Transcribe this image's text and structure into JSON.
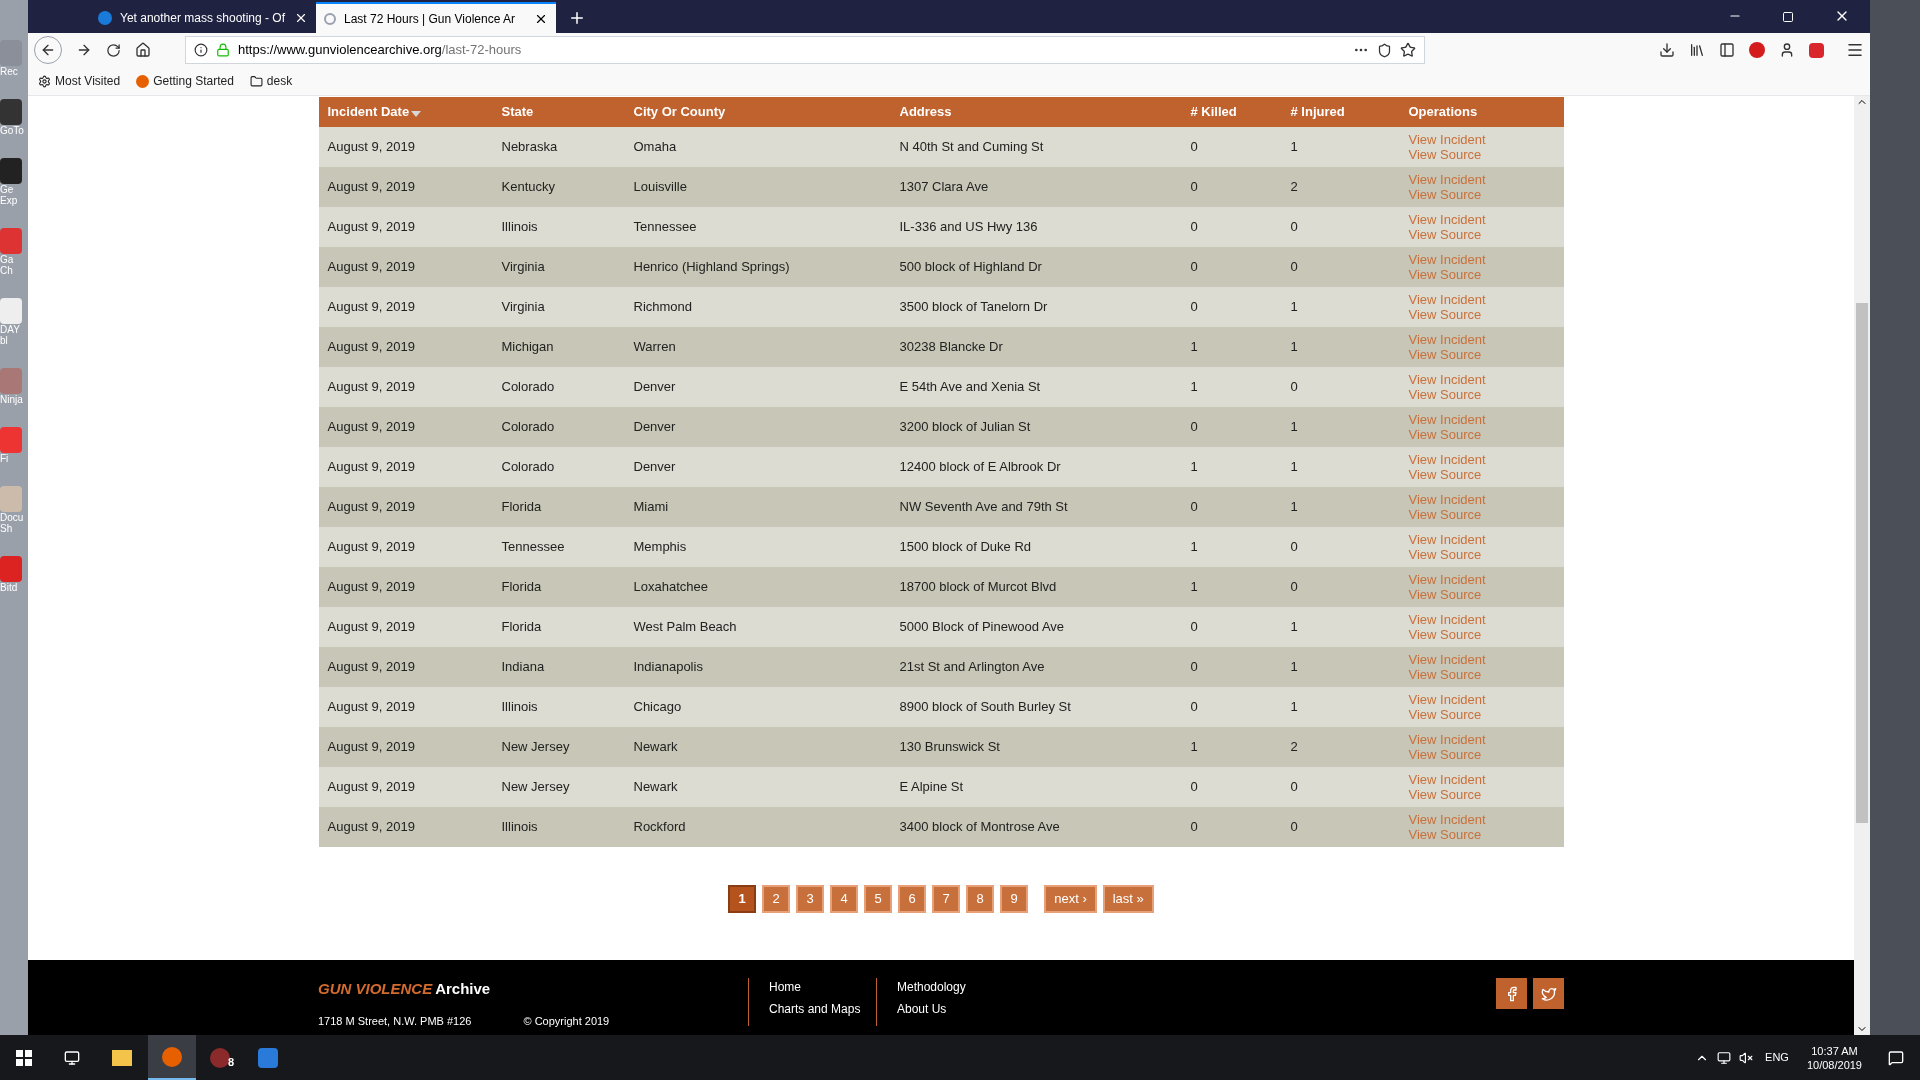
{
  "desktop_icons": [
    {
      "label": "Rec"
    },
    {
      "label": "GoTo"
    },
    {
      "label": "Ge Exp"
    },
    {
      "label": "Ga Ch"
    },
    {
      "label": "DAY bl"
    },
    {
      "label": "Ninja"
    },
    {
      "label": "Fi"
    },
    {
      "label": "Docu Sh"
    },
    {
      "label": "Bitd"
    }
  ],
  "tabs": [
    {
      "title": "Yet another mass shooting - Of",
      "selected": false
    },
    {
      "title": "Last 72 Hours | Gun Violence Ar",
      "selected": true
    }
  ],
  "address_bar": {
    "host": "https://www.gunviolencearchive.org",
    "path": "/last-72-hours"
  },
  "bookmarks": [
    "Most Visited",
    "Getting Started",
    "desk"
  ],
  "table": {
    "columns": [
      "Incident Date",
      "State",
      "City Or County",
      "Address",
      "# Killed",
      "# Injured",
      "Operations"
    ],
    "rows": [
      [
        "August 9, 2019",
        "Nebraska",
        "Omaha",
        "N 40th St and Cuming St",
        "0",
        "1",
        "View Incident",
        "View Source"
      ],
      [
        "August 9, 2019",
        "Kentucky",
        "Louisville",
        "1307 Clara Ave",
        "0",
        "2",
        "View Incident",
        "View Source"
      ],
      [
        "August 9, 2019",
        "Illinois",
        "Tennessee",
        "IL-336 and US Hwy 136",
        "0",
        "0",
        "View Incident",
        "View Source"
      ],
      [
        "August 9, 2019",
        "Virginia",
        "Henrico (Highland Springs)",
        "500 block of Highland Dr",
        "0",
        "0",
        "View Incident",
        "View Source"
      ],
      [
        "August 9, 2019",
        "Virginia",
        "Richmond",
        "3500 block of Tanelorn Dr",
        "0",
        "1",
        "View Incident",
        "View Source"
      ],
      [
        "August 9, 2019",
        "Michigan",
        "Warren",
        "30238 Blancke Dr",
        "1",
        "1",
        "View Incident",
        "View Source"
      ],
      [
        "August 9, 2019",
        "Colorado",
        "Denver",
        "E 54th Ave and Xenia St",
        "1",
        "0",
        "View Incident",
        "View Source"
      ],
      [
        "August 9, 2019",
        "Colorado",
        "Denver",
        "3200 block of Julian St",
        "0",
        "1",
        "View Incident",
        "View Source"
      ],
      [
        "August 9, 2019",
        "Colorado",
        "Denver",
        "12400 block of E Albrook Dr",
        "1",
        "1",
        "View Incident",
        "View Source"
      ],
      [
        "August 9, 2019",
        "Florida",
        "Miami",
        "NW Seventh Ave and 79th St",
        "0",
        "1",
        "View Incident",
        "View Source"
      ],
      [
        "August 9, 2019",
        "Tennessee",
        "Memphis",
        "1500 block of Duke Rd",
        "1",
        "0",
        "View Incident",
        "View Source"
      ],
      [
        "August 9, 2019",
        "Florida",
        "Loxahatchee",
        "18700 block of Murcot Blvd",
        "1",
        "0",
        "View Incident",
        "View Source"
      ],
      [
        "August 9, 2019",
        "Florida",
        "West Palm Beach",
        "5000 Block of Pinewood Ave",
        "0",
        "1",
        "View Incident",
        "View Source"
      ],
      [
        "August 9, 2019",
        "Indiana",
        "Indianapolis",
        "21st St and Arlington Ave",
        "0",
        "1",
        "View Incident",
        "View Source"
      ],
      [
        "August 9, 2019",
        "Illinois",
        "Chicago",
        "8900 block of South Burley St",
        "0",
        "1",
        "View Incident",
        "View Source"
      ],
      [
        "August 9, 2019",
        "New Jersey",
        "Newark",
        "130 Brunswick St",
        "1",
        "2",
        "View Incident",
        "View Source"
      ],
      [
        "August 9, 2019",
        "New Jersey",
        "Newark",
        "E Alpine St",
        "0",
        "0",
        "View Incident",
        "View Source"
      ],
      [
        "August 9, 2019",
        "Illinois",
        "Rockford",
        "3400 block of Montrose Ave",
        "0",
        "0",
        "View Incident",
        "View Source"
      ]
    ]
  },
  "pager": [
    {
      "label": "1",
      "selected": true
    },
    {
      "label": "2",
      "selected": false
    },
    {
      "label": "3",
      "selected": false
    },
    {
      "label": "4",
      "selected": false
    },
    {
      "label": "5",
      "selected": false
    },
    {
      "label": "6",
      "selected": false
    },
    {
      "label": "7",
      "selected": false
    },
    {
      "label": "8",
      "selected": false
    },
    {
      "label": "9",
      "selected": false
    },
    {
      "label": "next ›",
      "selected": false
    },
    {
      "label": "last »",
      "selected": false
    }
  ],
  "footer": {
    "logo_main": "GUN VIOLENCE",
    "logo_sub": "Archive",
    "address": "1718 M Street, N.W. PMB #126",
    "copyright": "© Copyright 2019",
    "links": [
      [
        "Home",
        "Charts and Maps"
      ],
      [
        "Methodology",
        "About Us"
      ]
    ]
  },
  "taskbar": {
    "badge": "8",
    "language": "ENG",
    "time": "10:37 AM",
    "date": "10/08/2019"
  }
}
